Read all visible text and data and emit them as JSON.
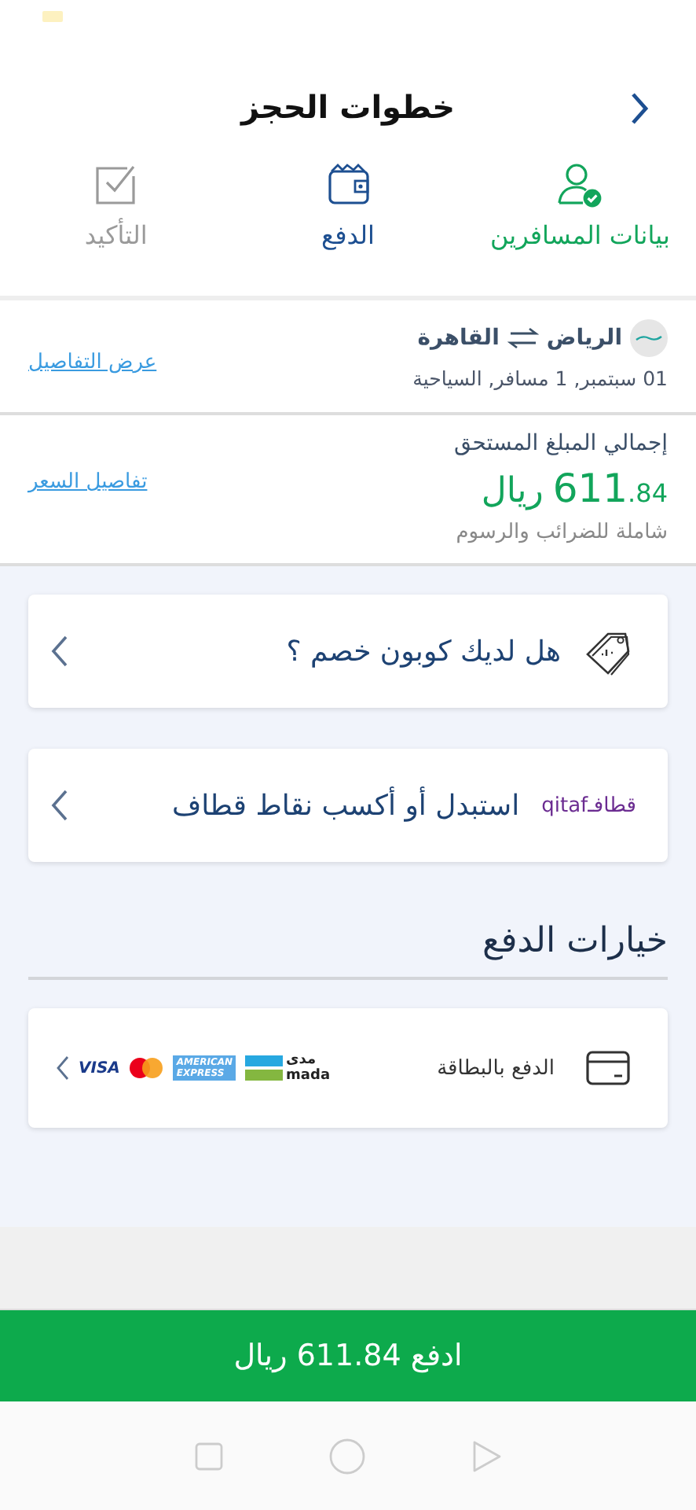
{
  "header": {
    "title": "خطوات الحجز"
  },
  "steps": [
    {
      "label": "بيانات المسافرين",
      "completed": true,
      "selected": false
    },
    {
      "label": "الدفع",
      "completed": false,
      "selected": true
    },
    {
      "label": "التأكيد",
      "completed": false,
      "selected": false
    }
  ],
  "flight": {
    "route_from": "الرياض",
    "route_to": "القاهرة",
    "details": "01 سبتمبر, 1 مسافر, السياحية",
    "link": "عرض التفاصيل"
  },
  "price": {
    "label": "إجمالي المبلغ المستحق",
    "amount_major": "611",
    "amount_minor": ".84",
    "currency": "ريال",
    "note": "شاملة للضرائب والرسوم",
    "link": "تفاصيل السعر"
  },
  "offers": [
    {
      "kind": "coupon",
      "text": "هل لديك كوبون خصم ؟"
    },
    {
      "kind": "qitaf",
      "brand_ar": "قطافـ",
      "brand_en": "qitaf",
      "text": "استبدل أو أكسب نقاط قطاف"
    }
  ],
  "payment_section": {
    "title": "خيارات الدفع",
    "options": [
      {
        "label": "الدفع بالبطاقة",
        "brands": {
          "mada_ar": "مدى",
          "mada_en": "mada",
          "amex_top": "AMERICAN",
          "amex_bottom": "EXPRESS",
          "visa": "VISA"
        }
      }
    ]
  },
  "pay_button": "ادفع  611.84 ريال"
}
